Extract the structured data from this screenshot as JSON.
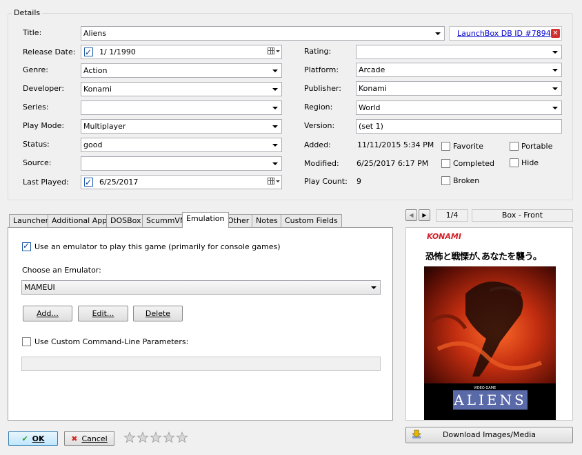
{
  "details": {
    "group_title": "Details",
    "title_label": "Title:",
    "title_value": "Aliens",
    "db_link": "LaunchBox DB ID #7894",
    "release_label": "Release Date:",
    "release_value": "1/  1/1990",
    "genre_label": "Genre:",
    "genre_value": "Action",
    "developer_label": "Developer:",
    "developer_value": "Konami",
    "series_label": "Series:",
    "series_value": "",
    "playmode_label": "Play Mode:",
    "playmode_value": "Multiplayer",
    "status_label": "Status:",
    "status_value": "good",
    "source_label": "Source:",
    "source_value": "",
    "lastplayed_label": "Last Played:",
    "lastplayed_value": "6/25/2017",
    "rating_label": "Rating:",
    "rating_value": "",
    "platform_label": "Platform:",
    "platform_value": "Arcade",
    "publisher_label": "Publisher:",
    "publisher_value": "Konami",
    "region_label": "Region:",
    "region_value": "World",
    "version_label": "Version:",
    "version_value": "(set 1)",
    "added_label": "Added:",
    "added_value": "11/11/2015 5:34 PM",
    "modified_label": "Modified:",
    "modified_value": "6/25/2017 6:17 PM",
    "playcount_label": "Play Count:",
    "playcount_value": "9",
    "flags": {
      "favorite": "Favorite",
      "completed": "Completed",
      "broken": "Broken",
      "portable": "Portable",
      "hide": "Hide"
    }
  },
  "tabs": [
    "Launcher",
    "Additional Apps",
    "DOSBox",
    "ScummVM",
    "Emulation",
    "Other",
    "Notes",
    "Custom Fields"
  ],
  "active_tab": "Emulation",
  "emulation": {
    "use_emulator_label": "Use an emulator to play this game (primarily for console games)",
    "choose_label": "Choose an Emulator:",
    "emulator_value": "MAMEUI",
    "add_btn": "Add...",
    "edit_btn": "Edit...",
    "delete_btn": "Delete",
    "custom_cmd_label": "Use Custom Command-Line Parameters:",
    "custom_cmd_value": ""
  },
  "media": {
    "counter": "1/4",
    "image_type": "Box - Front",
    "download_btn": "Download Images/Media",
    "cover_brand": "KONAMI",
    "cover_jp_title": "恐怖と戦慄が､あなたを襲う｡",
    "cover_video_game": "VIDEO GAME",
    "cover_logo": "ALIENS"
  },
  "footer": {
    "ok_btn": "OK",
    "cancel_btn": "Cancel"
  },
  "stars": {
    "rating": 0,
    "max": 5
  },
  "colors": {
    "link": "#0000cc",
    "close_red": "#d32f2f",
    "ok_check": "#2e9a2e",
    "cover_red": "#c32e10",
    "cover_konami": "#d21f26"
  }
}
